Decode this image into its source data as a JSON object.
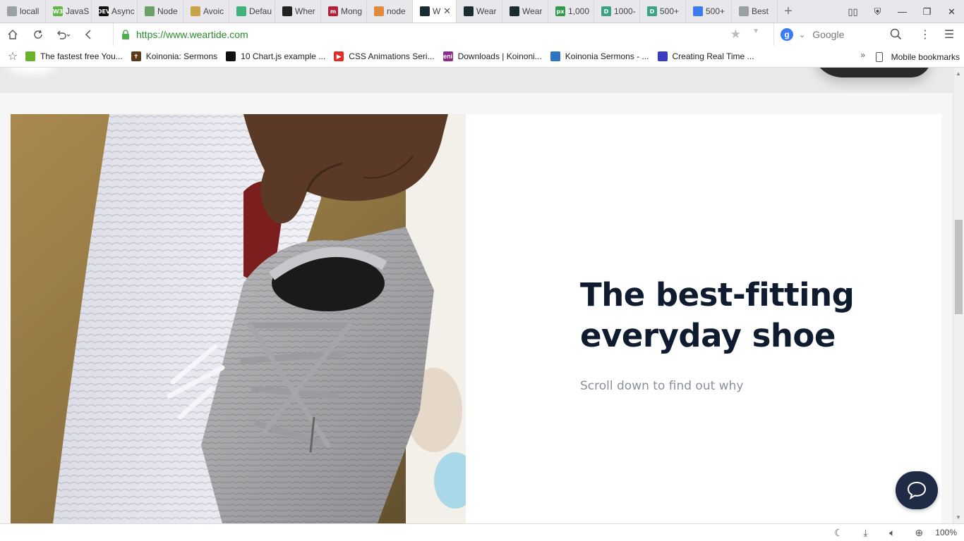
{
  "tabs": [
    {
      "label": "locall",
      "fav_color": "#9aa0a6",
      "fav_text": ""
    },
    {
      "label": "JavaS",
      "fav_color": "#5fb847",
      "fav_text": "W3"
    },
    {
      "label": "Async",
      "fav_color": "#111111",
      "fav_text": "DEV"
    },
    {
      "label": "Node",
      "fav_color": "#6a9f6a",
      "fav_text": ""
    },
    {
      "label": "Avoic",
      "fav_color": "#c9a34a",
      "fav_text": ""
    },
    {
      "label": "Defau",
      "fav_color": "#3fb27f",
      "fav_text": ""
    },
    {
      "label": "Wher",
      "fav_color": "#222222",
      "fav_text": ""
    },
    {
      "label": "Mong",
      "fav_color": "#b2203a",
      "fav_text": "m"
    },
    {
      "label": "node",
      "fav_color": "#e08a3c",
      "fav_text": ""
    },
    {
      "label": "W",
      "fav_color": "#1b2b34",
      "fav_text": "",
      "active": true
    },
    {
      "label": "Wear",
      "fav_color": "#1b2b34",
      "fav_text": ""
    },
    {
      "label": "Wear",
      "fav_color": "#1b2b34",
      "fav_text": ""
    },
    {
      "label": "1,000",
      "fav_color": "#2e9c4a",
      "fav_text": "px"
    },
    {
      "label": "1000-",
      "fav_color": "#3aa287",
      "fav_text": "D"
    },
    {
      "label": "500+",
      "fav_color": "#3aa287",
      "fav_text": "D"
    },
    {
      "label": "500+",
      "fav_color": "#3b7df0",
      "fav_text": ""
    },
    {
      "label": "Best",
      "fav_color": "#9aa0a6",
      "fav_text": ""
    }
  ],
  "address": {
    "url": "https://www.weartide.com",
    "search_engine": "Google",
    "search_engine_icon": "g"
  },
  "bookmarks": [
    {
      "label": "The fastest free You...",
      "fav_color": "#6ab42d",
      "fav_text": ""
    },
    {
      "label": "Koinonia: Sermons",
      "fav_color": "#5a3a1a",
      "fav_text": "✝"
    },
    {
      "label": "10 Chart.js example ...",
      "fav_color": "#111111",
      "fav_text": ""
    },
    {
      "label": "CSS Animations Seri...",
      "fav_color": "#e52d27",
      "fav_text": "▶"
    },
    {
      "label": "Downloads | Koinoni...",
      "fav_color": "#8a2b8a",
      "fav_text": "eni"
    },
    {
      "label": "Koinonia Sermons - ...",
      "fav_color": "#2f74c0",
      "fav_text": ""
    },
    {
      "label": "Creating Real Time ...",
      "fav_color": "#3b3bc0",
      "fav_text": ""
    }
  ],
  "bookmarks_more": "»",
  "mobile_bookmarks": "Mobile bookmarks",
  "hero": {
    "title": "The best-fitting everyday shoe",
    "subtitle": "Scroll down to find out why"
  },
  "status": {
    "zoom": "100%"
  },
  "colors": {
    "hero_title": "#0f1b2e",
    "hero_subtitle": "#8a8f98",
    "chat_button": "#1f2a44",
    "url_green": "#2a8a2a"
  }
}
